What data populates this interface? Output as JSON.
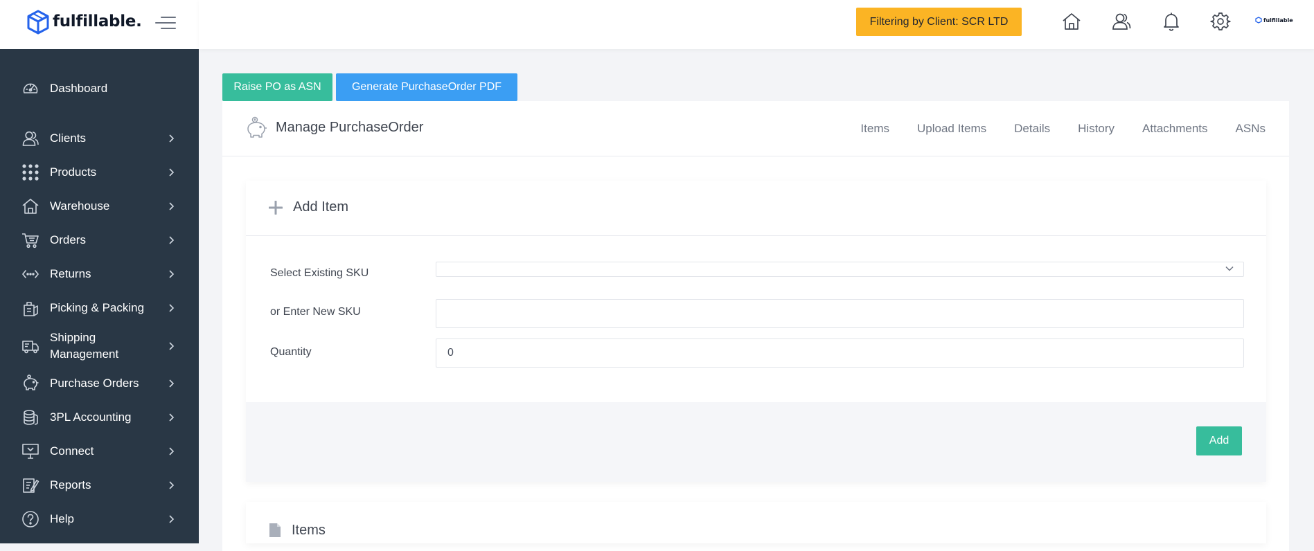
{
  "brand": {
    "name": "fulfillable.",
    "mini": "fulfillable"
  },
  "colors": {
    "sidebar": "#293745",
    "accent_green": "#37bd9c",
    "accent_blue": "#3b9ef3",
    "filter_badge": "#fbb424"
  },
  "sidebar": {
    "items": [
      {
        "label": "Dashboard",
        "icon": "dashboard-gauge-icon",
        "chevron": false
      },
      {
        "label": "Clients",
        "icon": "clients-user-icon",
        "chevron": true
      },
      {
        "label": "Products",
        "icon": "products-grid-icon",
        "chevron": true
      },
      {
        "label": "Warehouse",
        "icon": "warehouse-home-icon",
        "chevron": true
      },
      {
        "label": "Orders",
        "icon": "orders-cart-icon",
        "chevron": true
      },
      {
        "label": "Returns",
        "icon": "returns-arrows-icon",
        "chevron": true
      },
      {
        "label": "Picking & Packing",
        "icon": "picking-box-icon",
        "chevron": true
      },
      {
        "label": "Shipping",
        "label2": "Management",
        "icon": "shipping-truck-icon",
        "chevron": true
      },
      {
        "label": "Purchase Orders",
        "icon": "purchase-piggy-icon",
        "chevron": true
      },
      {
        "label": "3PL Accounting",
        "icon": "accounting-coins-icon",
        "chevron": true
      },
      {
        "label": "Connect",
        "icon": "connect-monitor-icon",
        "chevron": true
      },
      {
        "label": "Reports",
        "icon": "reports-note-icon",
        "chevron": true
      },
      {
        "label": "Help",
        "icon": "help-question-icon",
        "chevron": true
      }
    ]
  },
  "topbar": {
    "filter_badge": "Filtering by Client: SCR LTD",
    "icons": [
      "home-icon",
      "user-icon",
      "bell-icon",
      "gear-icon"
    ]
  },
  "actions": {
    "raise_po": "Raise PO as ASN",
    "generate_pdf": "Generate PurchaseOrder PDF"
  },
  "card": {
    "title": "Manage PurchaseOrder",
    "tabs": [
      "Items",
      "Upload Items",
      "Details",
      "History",
      "Attachments",
      "ASNs"
    ]
  },
  "add_item": {
    "title": "Add Item",
    "select_sku_label": "Select Existing SKU",
    "select_sku_value": "",
    "new_sku_label": "or Enter New SKU",
    "new_sku_value": "",
    "quantity_label": "Quantity",
    "quantity_value": "0",
    "add_button": "Add"
  },
  "items_section": {
    "title": "Items"
  }
}
